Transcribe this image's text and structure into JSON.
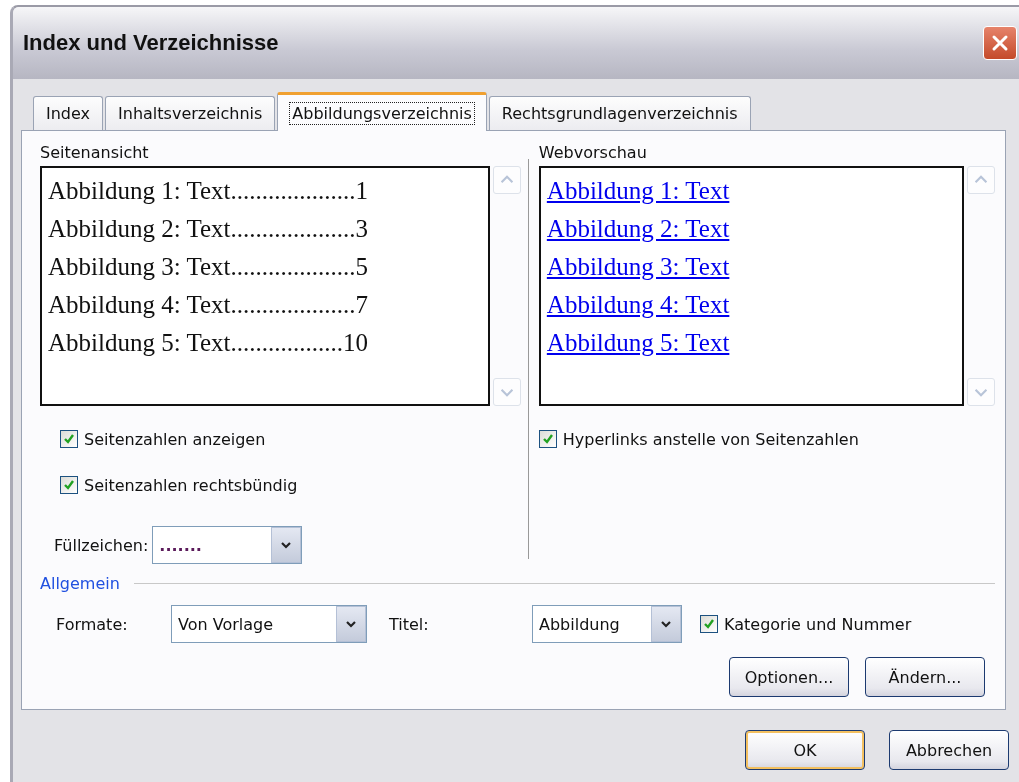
{
  "window": {
    "title": "Index und Verzeichnisse"
  },
  "tabs": [
    {
      "label": "Index",
      "selected": false
    },
    {
      "label": "Inhaltsverzeichnis",
      "selected": false
    },
    {
      "label": "Abbildungsverzeichnis",
      "selected": true
    },
    {
      "label": "Rechtsgrundlagenverzeichnis",
      "selected": false
    }
  ],
  "print_preview": {
    "label": "Seitenansicht",
    "entries": [
      {
        "text": "Abbildung 1: Text",
        "leader": "....................",
        "page": "1"
      },
      {
        "text": "Abbildung 2: Text",
        "leader": "....................",
        "page": "3"
      },
      {
        "text": "Abbildung 3: Text",
        "leader": "....................",
        "page": "5"
      },
      {
        "text": "Abbildung 4: Text",
        "leader": "....................",
        "page": "7"
      },
      {
        "text": "Abbildung 5: Text",
        "leader": "..................",
        "page": "10"
      }
    ]
  },
  "web_preview": {
    "label": "Webvorschau",
    "links": [
      "Abbildung 1: Text",
      "Abbildung 2: Text",
      "Abbildung 3: Text",
      "Abbildung 4: Text",
      "Abbildung 5: Text"
    ]
  },
  "left_options": [
    {
      "label": "Seitenzahlen anzeigen",
      "checked": true
    },
    {
      "label": "Seitenzahlen rechtsbündig",
      "checked": true
    }
  ],
  "right_options": [
    {
      "label": "Hyperlinks anstelle von Seitenzahlen",
      "checked": true
    }
  ],
  "tab_leader": {
    "label": "Füllzeichen:",
    "value": "......."
  },
  "general": {
    "label": "Allgemein",
    "formats_label": "Formate:",
    "formats_value": "Von Vorlage",
    "caption_label": "Titel:",
    "caption_value": "Abbildung",
    "label_and_number": {
      "label": "Kategorie und Nummer",
      "checked": true
    }
  },
  "panel_buttons": [
    "Optionen...",
    "Ändern..."
  ],
  "dialog_buttons": [
    {
      "label": "OK",
      "default": true
    },
    {
      "label": "Abbrechen",
      "default": false
    }
  ]
}
